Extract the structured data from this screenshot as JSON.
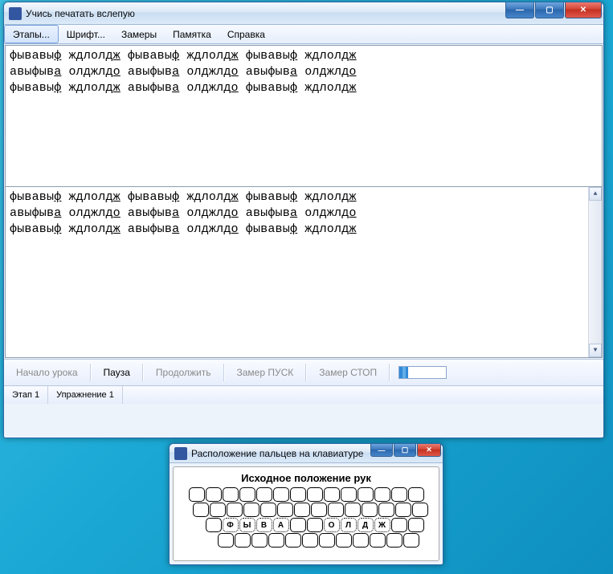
{
  "main_window": {
    "title": "Учись печатать вслепую",
    "menu": [
      "Этапы...",
      "Шрифт...",
      "Замеры",
      "Памятка",
      "Справка"
    ],
    "pane1_lines": [
      "фывавыф ждлолдж фывавыф ждлолдж фывавыф ждлолдж",
      "авыфыва олджлдо авыфыва олджлдо авыфыва олджлдо",
      "фывавыф ждлолдж авыфыва олджлдо фывавыф ждлолдж"
    ],
    "pane2_lines": [
      "фывавыф ждлолдж фывавыф ждлолдж фывавыф ждлолдж",
      "авыфыва олджлдо авыфыва олджлдо авыфыва олджлдо",
      "фывавыф ждлолдж авыфыва олджлдо фывавыф ждлолдж"
    ],
    "toolbar": {
      "start_lesson": "Начало урока",
      "pause": "Пауза",
      "continue": "Продолжить",
      "measure_start": "Замер ПУСК",
      "measure_stop": "Замер СТОП",
      "progress_pct": 18
    },
    "status": {
      "stage": "Этап 1",
      "exercise": "Упражнение 1"
    }
  },
  "small_window": {
    "title": "Расположение пальцев на клавиатуре",
    "heading": "Исходное положение рук",
    "home_keys": [
      "Ф",
      "Ы",
      "В",
      "А",
      "О",
      "Л",
      "Д",
      "Ж"
    ]
  }
}
